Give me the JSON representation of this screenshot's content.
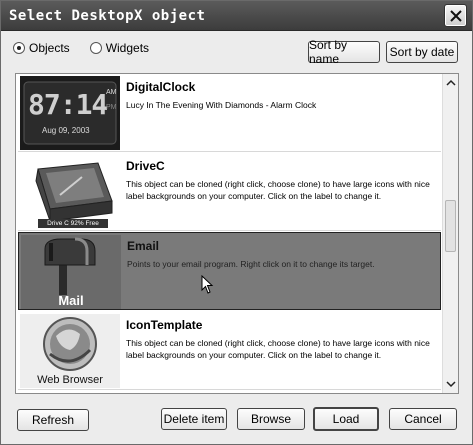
{
  "window": {
    "title": "Select DesktopX object"
  },
  "filters": {
    "objects_label": "Objects",
    "widgets_label": "Widgets",
    "selected": "Objects"
  },
  "sort": {
    "by_name_label": "Sort by name",
    "by_date_label": "Sort by date"
  },
  "items": [
    {
      "name": "DigitalClock",
      "description": "Lucy In The Evening With Diamonds - Alarm Clock",
      "thumb": {
        "time": "87:14",
        "ampm_top": "AM",
        "ampm_bottom": "PM",
        "date": "Aug 09, 2003"
      }
    },
    {
      "name": "DriveC",
      "description": "This object can be cloned (right click, choose clone) to have large icons with nice label backgrounds on your computer. Click on the label to change it.",
      "thumb": {
        "caption": "Drive C 92% Free"
      }
    },
    {
      "name": "Email",
      "description": "Points to your email program. Right click on it to change its target.",
      "thumb": {
        "caption": "Mail"
      },
      "selected": true
    },
    {
      "name": "IconTemplate",
      "description": "This object can be cloned (right click, choose clone) to have large icons with nice label backgrounds on your computer. Click on the label to change it.",
      "thumb": {
        "caption": "Web Browser"
      }
    }
  ],
  "footer": {
    "refresh_label": "Refresh",
    "delete_label": "Delete item",
    "browse_label": "Browse",
    "load_label": "Load",
    "cancel_label": "Cancel"
  },
  "colors": {
    "titlebar": "#4a4a4a",
    "selection": "#7a7a7a"
  }
}
